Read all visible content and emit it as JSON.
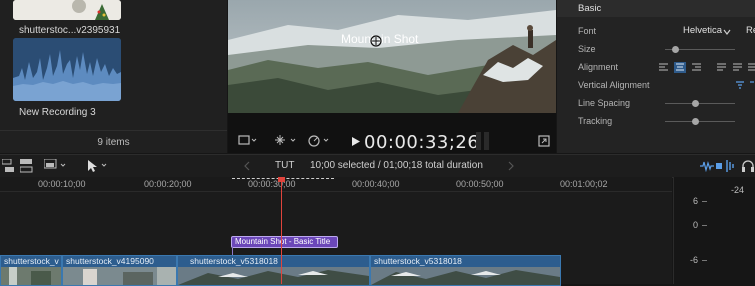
{
  "browser": {
    "clip1_label": "shutterstoc...v2395931",
    "clip2_label": "New Recording 3",
    "footer": "9 items"
  },
  "viewer": {
    "title_overlay": "Mountain Shot",
    "timecode": "00:00:33;26"
  },
  "inspector": {
    "section": "Basic",
    "font_label": "Font",
    "font_value": "Helvetica",
    "font_value2": "Re",
    "size_label": "Size",
    "alignment_label": "Alignment",
    "vertical_alignment_label": "Vertical Alignment",
    "line_spacing_label": "Line Spacing",
    "tracking_label": "Tracking"
  },
  "timeline_toolbar": {
    "project_name": "TUT",
    "selection_info": "10;00 selected / 01;00;18 total duration"
  },
  "ruler": {
    "ticks": [
      "00:00:10;00",
      "00:00:20;00",
      "00:00:30;00",
      "00:00:40;00",
      "00:00:50;00",
      "00:01:00;02"
    ]
  },
  "timeline": {
    "title_clip": "Mountain Shot - Basic Title",
    "clips": [
      "shutterstock_v",
      "shutterstock_v4195090",
      "shutterstock_v5318018",
      "shutterstock_v5318018"
    ]
  },
  "meter": {
    "labels": [
      "-24",
      "6",
      "0",
      "-6"
    ]
  },
  "colors": {
    "accent": "#3a78b0",
    "title_clip": "#6b47b8",
    "playhead": "#e0443c"
  }
}
